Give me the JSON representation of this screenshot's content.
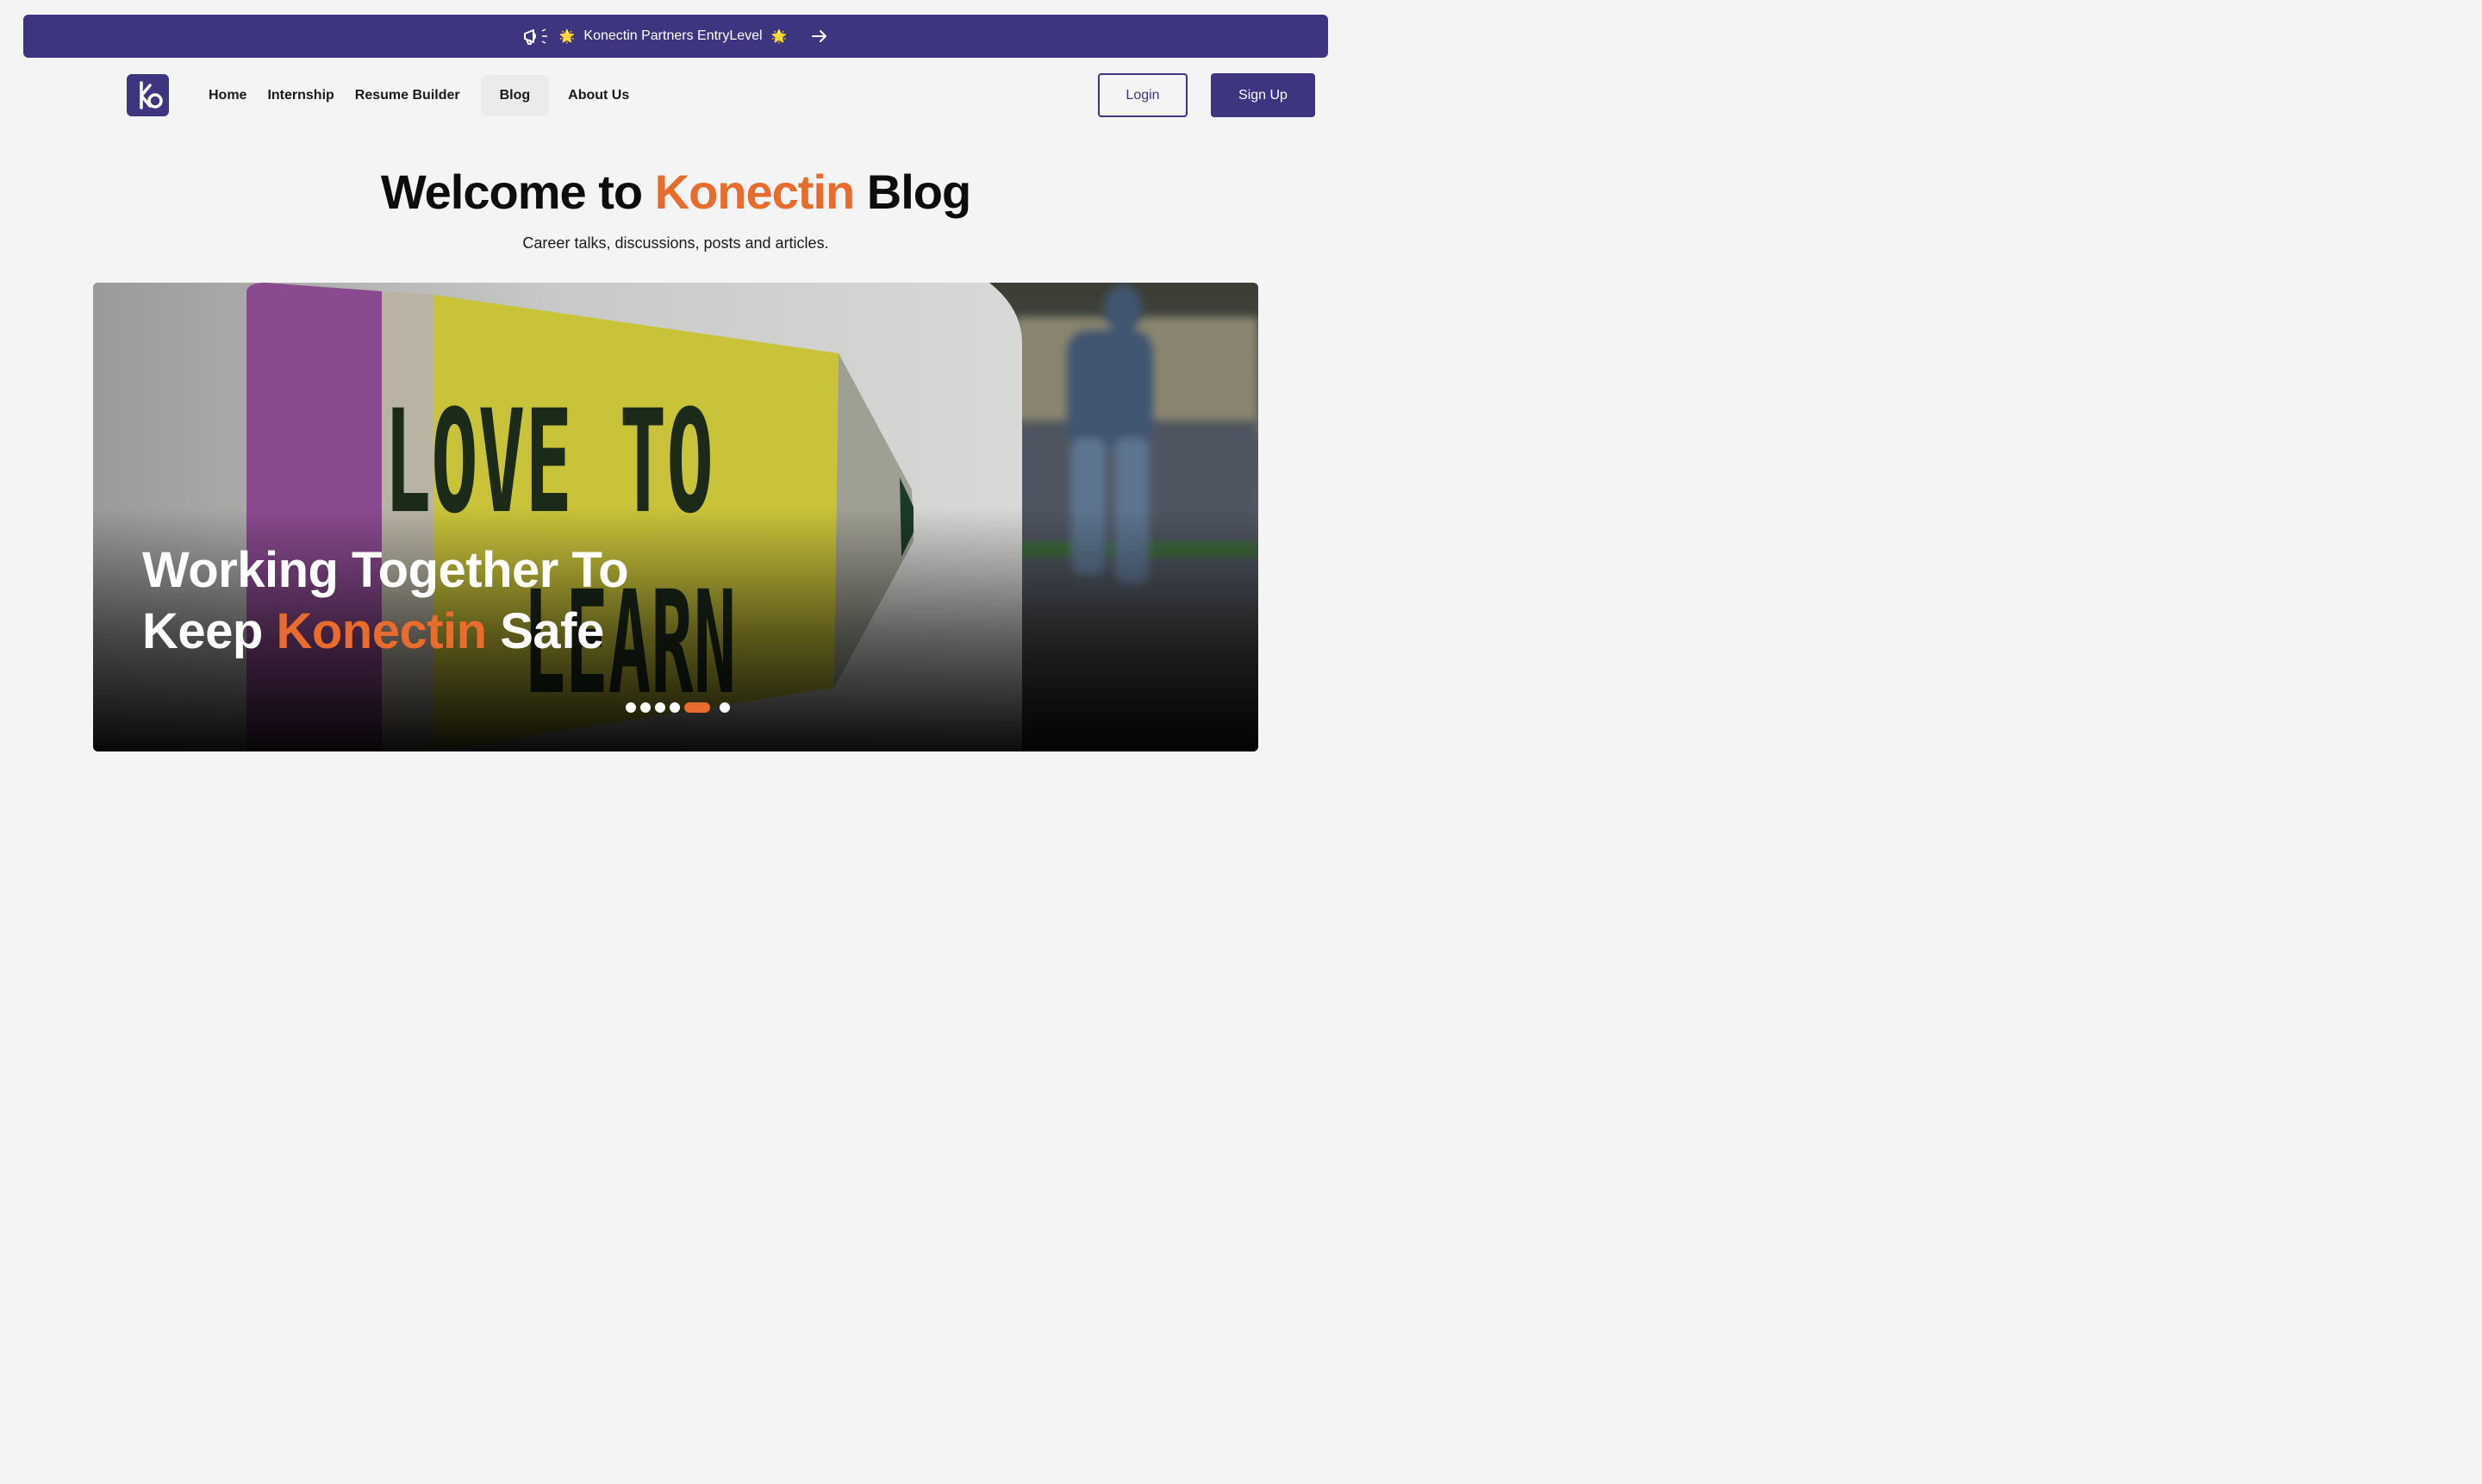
{
  "banner": {
    "text": "Konectin Partners EntryLevel",
    "sparkle": "🌟",
    "icons": [
      "megaphone-icon",
      "arrow-right-icon"
    ]
  },
  "nav": {
    "items": [
      {
        "label": "Home"
      },
      {
        "label": "Internship"
      },
      {
        "label": "Resume Builder"
      },
      {
        "label": "Blog",
        "active": true
      },
      {
        "label": "About Us"
      }
    ],
    "login": "Login",
    "signup": "Sign Up"
  },
  "heading": {
    "pre": "Welcome to",
    "accent": "Konectin",
    "post": "Blog",
    "subtitle": "Career talks, discussions, posts and articles."
  },
  "hero": {
    "title_line1": "Working Together To",
    "title_pre": "Keep",
    "title_accent": "Konectin",
    "title_post": "Safe",
    "slide_count": 6,
    "active_slide": 5
  },
  "colors": {
    "brand": "#3d3580",
    "accent": "#e96b2e",
    "background": "#f4f4f4"
  }
}
